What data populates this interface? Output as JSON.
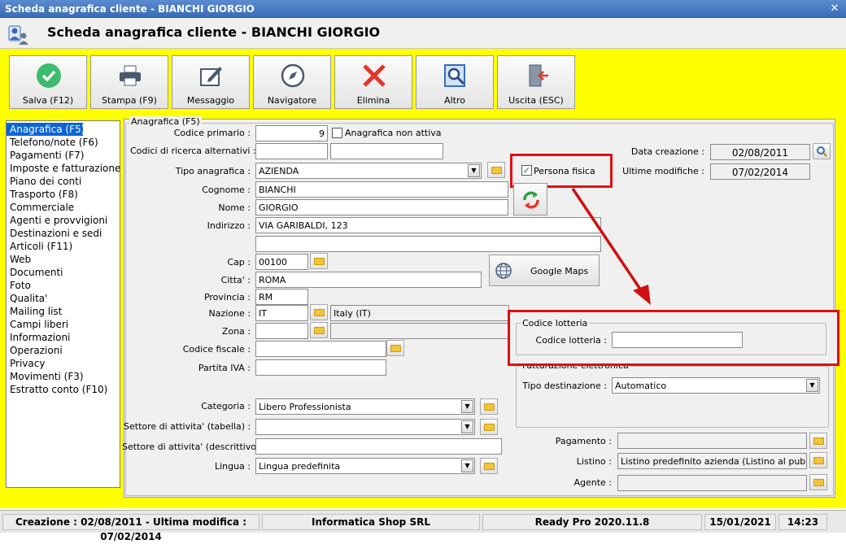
{
  "window": {
    "title": "Scheda anagrafica cliente - BIANCHI GIORGIO",
    "close": "✕"
  },
  "header": {
    "title": "Scheda anagrafica cliente - BIANCHI GIORGIO"
  },
  "toolbar": {
    "save": "Salva (F12)",
    "print": "Stampa (F9)",
    "message": "Messaggio",
    "navigator": "Navigatore",
    "delete": "Elimina",
    "other": "Altro",
    "exit": "Uscita (ESC)"
  },
  "sidebar": {
    "items": [
      {
        "label": "Anagrafica (F5)"
      },
      {
        "label": "Telefono/note (F6)"
      },
      {
        "label": "Pagamenti (F7)"
      },
      {
        "label": "Imposte e fatturazione"
      },
      {
        "label": "Piano dei conti"
      },
      {
        "label": "Trasporto (F8)"
      },
      {
        "label": "Commerciale"
      },
      {
        "label": "Agenti e provvigioni"
      },
      {
        "label": "Destinazioni e sedi"
      },
      {
        "label": "Articoli (F11)"
      },
      {
        "label": "Web"
      },
      {
        "label": "Documenti"
      },
      {
        "label": "Foto"
      },
      {
        "label": "Qualita'"
      },
      {
        "label": "Mailing list"
      },
      {
        "label": "Campi liberi"
      },
      {
        "label": "Informazioni"
      },
      {
        "label": "Operazioni"
      },
      {
        "label": "Privacy"
      },
      {
        "label": "Movimenti (F3)"
      },
      {
        "label": "Estratto conto (F10)"
      }
    ]
  },
  "form": {
    "group_title": "Anagrafica (F5)",
    "codice_primario": {
      "label": "Codice primario :",
      "value": "9"
    },
    "non_attiva": {
      "label": "Anagrafica non attiva"
    },
    "codici_ricerca": {
      "label": "Codici di ricerca alternativi :",
      "value1": "",
      "value2": ""
    },
    "tipo_anagrafica": {
      "label": "Tipo anagrafica :",
      "value": "AZIENDA"
    },
    "persona_fisica": {
      "label": "Persona fisica"
    },
    "cognome": {
      "label": "Cognome :",
      "value": "BIANCHI"
    },
    "nome": {
      "label": "Nome :",
      "value": "GIORGIO"
    },
    "indirizzo": {
      "label": "Indirizzo :",
      "value": "VIA GARIBALDI, 123",
      "value2": ""
    },
    "cap": {
      "label": "Cap :",
      "value": "00100"
    },
    "google_maps": "Google Maps",
    "citta": {
      "label": "Citta' :",
      "value": "ROMA"
    },
    "provincia": {
      "label": "Provincia :",
      "value": "RM"
    },
    "nazione": {
      "label": "Nazione :",
      "value": "IT",
      "description": "Italy (IT)"
    },
    "zona": {
      "label": "Zona :",
      "value": ""
    },
    "codice_fiscale": {
      "label": "Codice fiscale :",
      "value": ""
    },
    "partita_iva": {
      "label": "Partita IVA :",
      "value": ""
    },
    "categoria": {
      "label": "Categoria :",
      "value": "Libero Professionista"
    },
    "settore_tabella": {
      "label": "Settore di attivita' (tabella) :",
      "value": ""
    },
    "settore_descrittivo": {
      "label": "Settore di attivita' (descrittivo) :",
      "value": ""
    },
    "lingua": {
      "label": "Lingua :",
      "value": "Lingua predefinita"
    },
    "data_creazione": {
      "label": "Data creazione :",
      "value": "02/08/2011"
    },
    "ultime_modifiche": {
      "label": "Ultime modifiche :",
      "value": "07/02/2014"
    },
    "lotteria": {
      "group_title": "Codice lotteria",
      "label": "Codice lotteria :",
      "value": ""
    },
    "fatturazione": {
      "group_title": "Fatturazione elettronica",
      "tipo_label": "Tipo destinazione :",
      "tipo_value": "Automatico"
    },
    "pagamento": {
      "label": "Pagamento :",
      "value": ""
    },
    "listino": {
      "label": "Listino :",
      "value": "Listino predefinito azienda (Listino al pubblico)"
    },
    "agente": {
      "label": "Agente :",
      "value": ""
    }
  },
  "status": {
    "creation": "Creazione : 02/08/2011 - Ultima modifica : 07/02/2014",
    "company": "Informatica Shop SRL",
    "version": "Ready Pro 2020.11.8",
    "date": "15/01/2021",
    "time": "14:23"
  }
}
